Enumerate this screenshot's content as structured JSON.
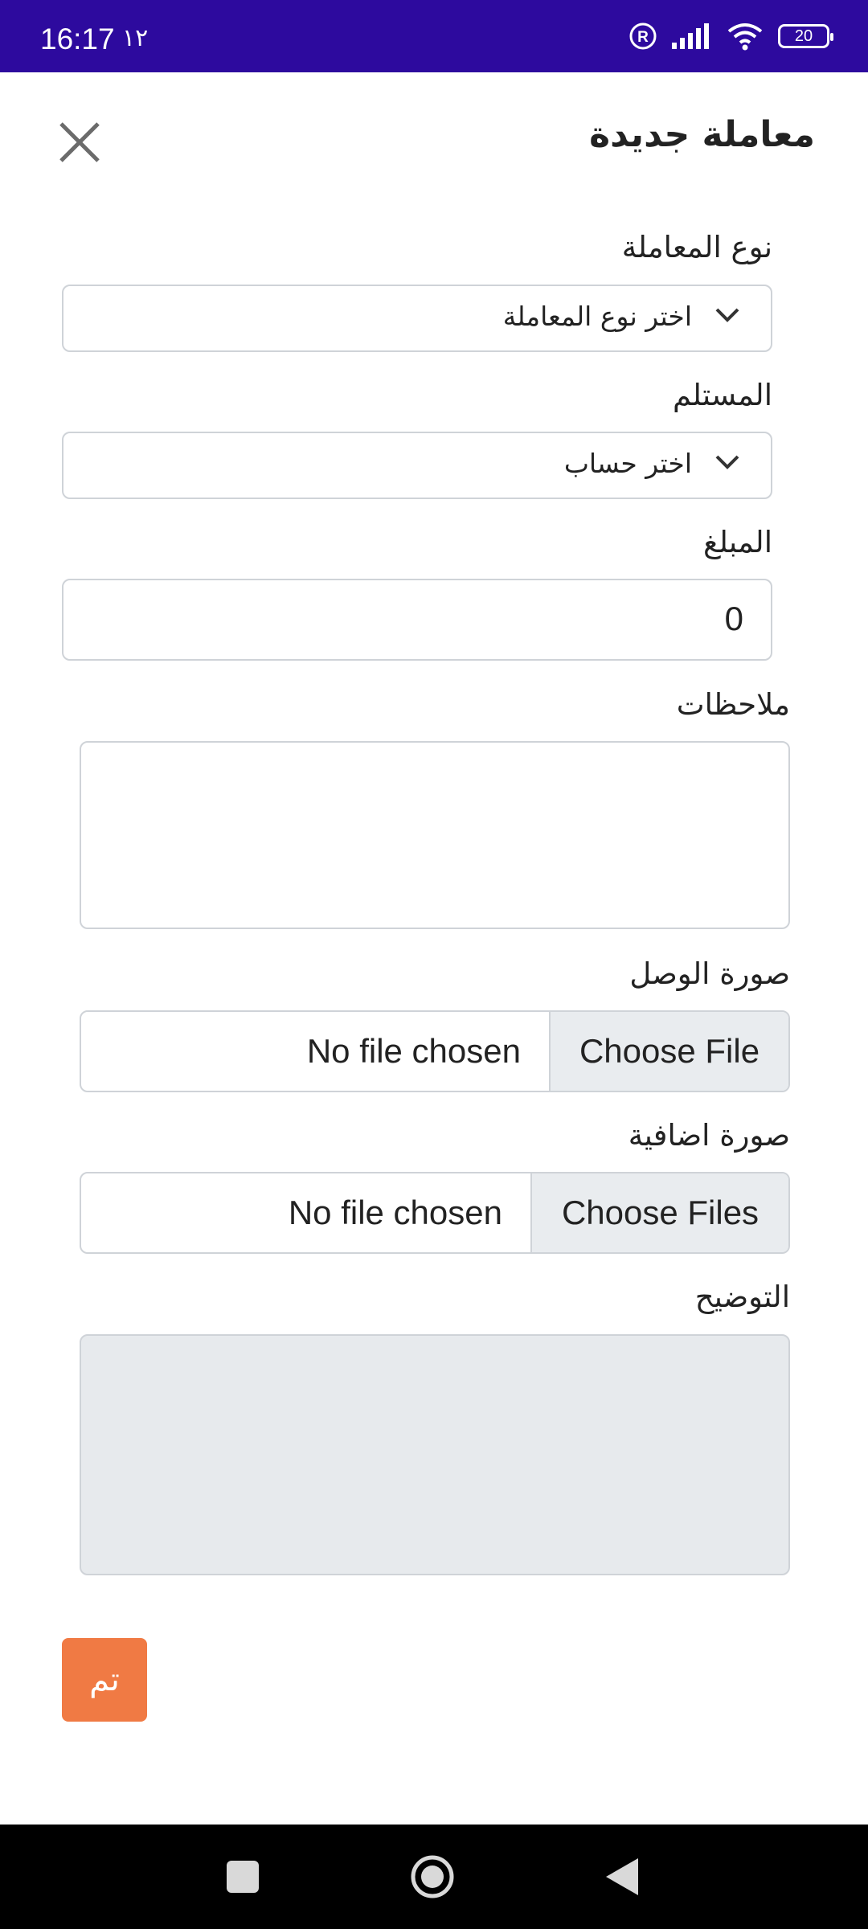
{
  "status_bar": {
    "time": "16:17",
    "extra": "١٢",
    "battery": "20"
  },
  "header": {
    "title": "معاملة جديدة"
  },
  "form": {
    "transaction_type": {
      "label": "نوع المعاملة",
      "selected": "اختر نوع المعاملة"
    },
    "recipient": {
      "label": "المستلم",
      "selected": "اختر حساب"
    },
    "amount": {
      "label": "المبلغ",
      "value": "0"
    },
    "notes": {
      "label": "ملاحظات",
      "value": ""
    },
    "receipt_image": {
      "label": "صورة الوصل",
      "button": "Choose File",
      "status": "No file chosen"
    },
    "extra_image": {
      "label": "صورة اضافية",
      "button": "Choose Files",
      "status": "No file chosen"
    },
    "description": {
      "label": "التوضيح",
      "value": ""
    },
    "submit_label": "تم"
  },
  "colors": {
    "status_bar": "#2d0a9e",
    "submit": "#f07a44",
    "disabled_field": "#e7eaed"
  },
  "icons": [
    "close-icon",
    "chevron-down-icon",
    "registered-icon",
    "signal-icon",
    "wifi-icon",
    "battery-icon",
    "square-nav-icon",
    "home-nav-icon",
    "back-nav-icon"
  ]
}
